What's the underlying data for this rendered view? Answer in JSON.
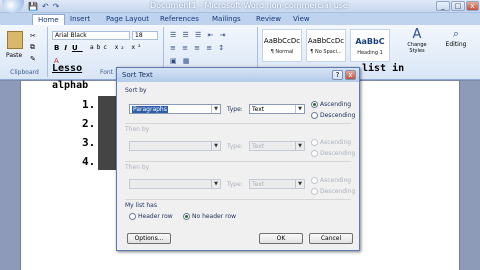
{
  "window": {
    "title": "Document1 - Microsoft Word non-commercial use"
  },
  "tabs": [
    "Home",
    "Insert",
    "Page Layout",
    "References",
    "Mailings",
    "Review",
    "View"
  ],
  "ribbon": {
    "clipboard": {
      "paste": "Paste",
      "label": "Clipboard"
    },
    "font": {
      "name": "Arial Black",
      "size": "18",
      "label": "Font"
    },
    "styles": [
      {
        "preview": "AaBbCcDc",
        "name": "¶ Normal"
      },
      {
        "preview": "AaBbCcDc",
        "name": "¶ No Spaci..."
      },
      {
        "preview": "AaBbC",
        "name": "Heading 1"
      }
    ],
    "change_styles": "Change Styles",
    "editing": "Editing"
  },
  "document": {
    "line1": "Lesso",
    "line1_tail": "list  in",
    "line2": "alphab",
    "numbers": [
      "1.",
      "2.",
      "3.",
      "4."
    ]
  },
  "dialog": {
    "title": "Sort Text",
    "sort_by": {
      "label": "Sort by",
      "value": "Paragraphs",
      "type_label": "Type:",
      "type_value": "Text",
      "ascending": "Ascending",
      "descending": "Descending"
    },
    "then_by1": {
      "label": "Then by",
      "type_label": "Type:",
      "type_value": "Text",
      "ascending": "Ascending",
      "descending": "Descending"
    },
    "then_by2": {
      "label": "Then by",
      "type_label": "Type:",
      "type_value": "Text",
      "ascending": "Ascending",
      "descending": "Descending"
    },
    "list_has": {
      "label": "My list has",
      "header_row": "Header row",
      "no_header_row": "No header row"
    },
    "options_button": "Options...",
    "ok_button": "OK",
    "cancel_button": "Cancel"
  }
}
